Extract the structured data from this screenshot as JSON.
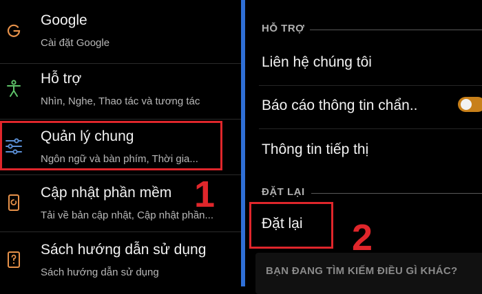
{
  "left_panel": {
    "items": [
      {
        "icon": "google-icon",
        "title": "Google",
        "subtitle": "Cài đặt Google"
      },
      {
        "icon": "accessibility-icon",
        "title": "Hỗ trợ",
        "subtitle": "Nhìn, Nghe, Thao tác và tương tác"
      },
      {
        "icon": "sliders-icon",
        "title": "Quản lý chung",
        "subtitle": "Ngôn ngữ và bàn phím, Thời gia..."
      },
      {
        "icon": "software-update-icon",
        "title": "Cập nhật phần mềm",
        "subtitle": "Tải về bản cập nhật, Cập nhật phần..."
      },
      {
        "icon": "user-manual-icon",
        "title": "Sách hướng dẫn sử dụng",
        "subtitle": "Sách hướng dẫn sử dụng"
      }
    ]
  },
  "right_panel": {
    "section_support": "HỖ TRỢ",
    "contact_us": "Liên hệ chúng tôi",
    "diagnostic_report": "Báo cáo thông tin chẩn..",
    "diagnostic_toggle_on": true,
    "marketing_info": "Thông tin tiếp thị",
    "section_reset": "ĐẶT LẠI",
    "reset": "Đặt lại",
    "search_prompt": "BẠN ĐANG TÌM KIẾM ĐIỀU GÌ KHÁC?"
  },
  "annotations": {
    "step1": "1",
    "step2": "2"
  },
  "colors": {
    "highlight": "#e0262b",
    "accent_toggle": "#c8801a",
    "panel_divider": "#2f6fd6"
  }
}
